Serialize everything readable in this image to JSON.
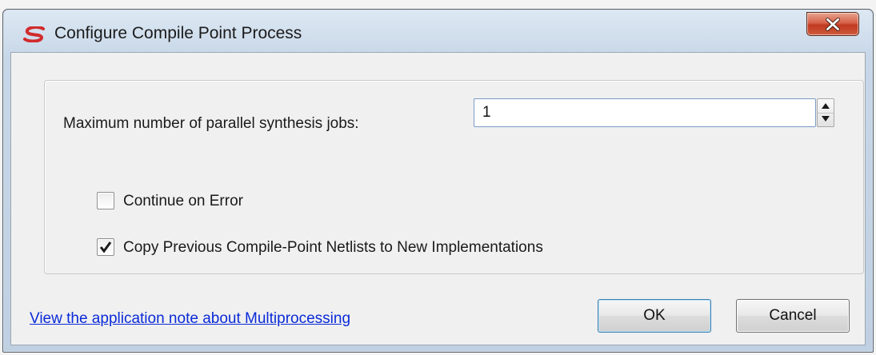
{
  "window": {
    "title": "Configure Compile Point Process",
    "logo_icon": "synplify-logo-icon",
    "close_icon": "close-icon"
  },
  "form": {
    "jobs_label": "Maximum number of parallel synthesis jobs:",
    "jobs_value": "1",
    "continue_on_error": {
      "label": "Continue on Error",
      "checked": false
    },
    "copy_netlists": {
      "label": "Copy Previous Compile-Point Netlists to New Implementations",
      "checked": true
    }
  },
  "footer": {
    "help_link": "View the application note about Multiprocessing",
    "ok_label": "OK",
    "cancel_label": "Cancel"
  },
  "colors": {
    "link": "#0b2bd8",
    "close_button": "#c0391f",
    "logo": "#d22b2b"
  }
}
